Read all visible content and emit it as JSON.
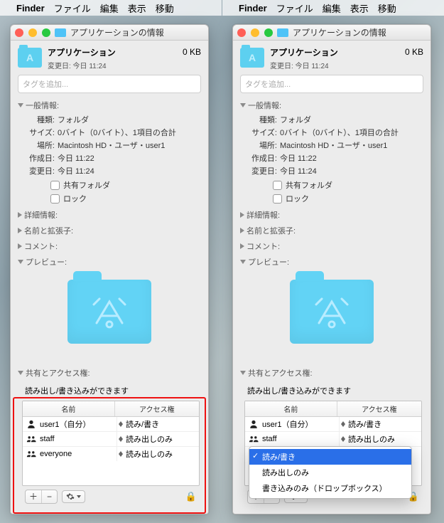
{
  "menubar": {
    "app": "Finder",
    "items": [
      "ファイル",
      "編集",
      "表示",
      "移動"
    ]
  },
  "window": {
    "title": "アプリケーションの情報",
    "folder_name": "アプリケーション",
    "size": "0 KB",
    "modified_line": "変更日: 今日 11:24",
    "tags_placeholder": "タグを追加..."
  },
  "sections": {
    "general": "一般情報:",
    "more": "詳細情報:",
    "nameext": "名前と拡張子:",
    "comments": "コメント:",
    "preview": "プレビュー:",
    "sharing": "共有とアクセス権:"
  },
  "general": {
    "kind_k": "種類:",
    "kind_v": "フォルダ",
    "size_k": "サイズ:",
    "size_v": "0バイト（0バイト）、1項目の合計",
    "where_k": "場所:",
    "where_v": "Macintosh HD・ユーザ・user1",
    "created_k": "作成日:",
    "created_v": "今日 11:22",
    "modified_k": "変更日:",
    "modified_v": "今日 11:24",
    "shared_cb": "共有フォルダ",
    "locked_cb": "ロック"
  },
  "sharing": {
    "hint": "読み出し/書き込みができます",
    "col_name": "名前",
    "col_perm": "アクセス権",
    "rows": [
      {
        "name": "user1（自分）",
        "perm": "読み/書き",
        "type": "single"
      },
      {
        "name": "staff",
        "perm": "読み出しのみ",
        "type": "group"
      },
      {
        "name": "everyone",
        "perm": "読み出しのみ",
        "type": "group"
      }
    ]
  },
  "dropdown": {
    "options": [
      "読み/書き",
      "読み出しのみ",
      "書き込みのみ（ドロップボックス）"
    ],
    "selected_index": 0
  },
  "toolbar": {
    "plus": "＋",
    "minus": "−"
  }
}
